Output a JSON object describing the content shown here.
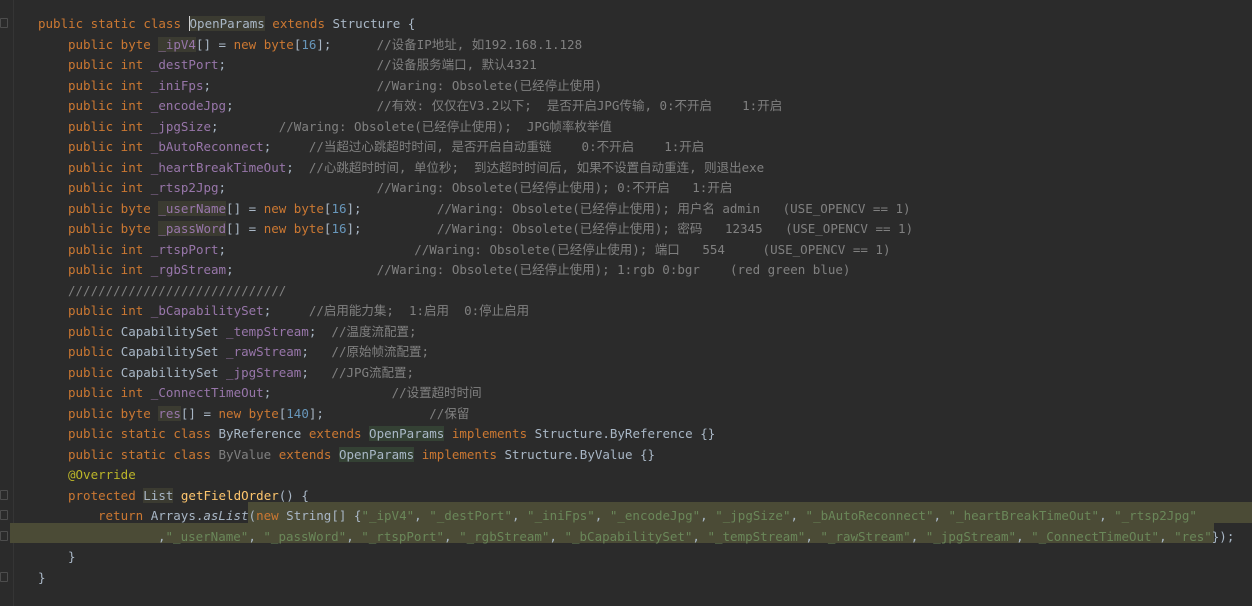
{
  "editor": {
    "language": "java",
    "lines": [
      {
        "indent": 0,
        "parts": [
          [
            "public static class ",
            "kw"
          ],
          [
            "OpenParams",
            "hl caret-before"
          ],
          [
            " extends ",
            "kw"
          ],
          [
            "Structure {",
            ""
          ]
        ]
      },
      {
        "indent": 1,
        "parts": [
          [
            "public byte ",
            "kw"
          ],
          [
            "_ipV4",
            "hl fld"
          ],
          [
            "[] = ",
            ""
          ],
          [
            "new ",
            "kw"
          ],
          [
            "byte",
            "kw"
          ],
          [
            "[",
            ""
          ],
          [
            "16",
            "num"
          ],
          [
            "];",
            ""
          ],
          [
            "      //设备IP地址, 如192.168.1.128",
            "cmt"
          ]
        ]
      },
      {
        "indent": 1,
        "parts": [
          [
            "public int ",
            "kw"
          ],
          [
            "_destPort",
            "fld"
          ],
          [
            ";",
            ""
          ],
          [
            "                    //设备服务端口, 默认4321",
            "cmt"
          ]
        ]
      },
      {
        "indent": 1,
        "parts": [
          [
            "public int ",
            "kw"
          ],
          [
            "_iniFps",
            "fld"
          ],
          [
            ";",
            ""
          ],
          [
            "                      //Waring: Obsolete(已经停止使用)",
            "cmt"
          ]
        ]
      },
      {
        "indent": 1,
        "parts": [
          [
            "public int ",
            "kw"
          ],
          [
            "_encodeJpg",
            "fld"
          ],
          [
            ";",
            ""
          ],
          [
            "                   //有效: 仅仅在V3.2以下;  是否开启JPG传输, 0:不开启    1:开启",
            "cmt"
          ]
        ]
      },
      {
        "indent": 1,
        "parts": [
          [
            "public int ",
            "kw"
          ],
          [
            "_jpgSize",
            "fld"
          ],
          [
            ";",
            ""
          ],
          [
            "        //Waring: Obsolete(已经停止使用);  JPG帧率枚举值",
            "cmt"
          ]
        ]
      },
      {
        "indent": 1,
        "parts": [
          [
            "public int ",
            "kw"
          ],
          [
            "_bAutoReconnect",
            "fld"
          ],
          [
            ";",
            ""
          ],
          [
            "     //当超过心跳超时时间, 是否开启自动重链    0:不开启    1:开启",
            "cmt"
          ]
        ]
      },
      {
        "indent": 1,
        "parts": [
          [
            "public int ",
            "kw"
          ],
          [
            "_heartBreakTimeOut",
            "fld"
          ],
          [
            ";",
            ""
          ],
          [
            "  //心跳超时时间, 单位秒;  到达超时时间后, 如果不设置自动重连, 则退出exe",
            "cmt"
          ]
        ]
      },
      {
        "indent": 1,
        "parts": [
          [
            "public int ",
            "kw"
          ],
          [
            "_rtsp2Jpg",
            "fld"
          ],
          [
            ";",
            ""
          ],
          [
            "                    //Waring: Obsolete(已经停止使用); 0:不开启   1:开启",
            "cmt"
          ]
        ]
      },
      {
        "indent": 1,
        "parts": [
          [
            "public byte ",
            "kw"
          ],
          [
            "_userName",
            "hl fld"
          ],
          [
            "[] = ",
            ""
          ],
          [
            "new ",
            "kw"
          ],
          [
            "byte",
            "kw"
          ],
          [
            "[",
            ""
          ],
          [
            "16",
            "num"
          ],
          [
            "];",
            ""
          ],
          [
            "          //Waring: Obsolete(已经停止使用); 用户名 admin   (USE_OPENCV == 1)",
            "cmt"
          ]
        ]
      },
      {
        "indent": 1,
        "parts": [
          [
            "public byte ",
            "kw"
          ],
          [
            "_passWord",
            "hl fld"
          ],
          [
            "[] = ",
            ""
          ],
          [
            "new ",
            "kw"
          ],
          [
            "byte",
            "kw"
          ],
          [
            "[",
            ""
          ],
          [
            "16",
            "num"
          ],
          [
            "];",
            ""
          ],
          [
            "          //Waring: Obsolete(已经停止使用); 密码   12345   (USE_OPENCV == 1)",
            "cmt"
          ]
        ]
      },
      {
        "indent": 1,
        "parts": [
          [
            "public int ",
            "kw"
          ],
          [
            "_rtspPort",
            "fld"
          ],
          [
            ";",
            ""
          ],
          [
            "                         //Waring: Obsolete(已经停止使用); 端口   554     (USE_OPENCV == 1)",
            "cmt"
          ]
        ]
      },
      {
        "indent": 1,
        "parts": [
          [
            "public int ",
            "kw"
          ],
          [
            "_rgbStream",
            "fld"
          ],
          [
            ";",
            ""
          ],
          [
            "                   //Waring: Obsolete(已经停止使用); 1:rgb 0:bgr    (red green blue)",
            "cmt"
          ]
        ]
      },
      {
        "indent": 1,
        "parts": [
          [
            "/////////////////////////////",
            "cmt"
          ]
        ]
      },
      {
        "indent": 1,
        "parts": [
          [
            "public int ",
            "kw"
          ],
          [
            "_bCapabilitySet",
            "fld"
          ],
          [
            ";",
            ""
          ],
          [
            "     //启用能力集;  1:启用  0:停止启用",
            "cmt"
          ]
        ]
      },
      {
        "indent": 1,
        "parts": [
          [
            "public ",
            "kw"
          ],
          [
            "CapabilitySet ",
            ""
          ],
          [
            "_tempStream",
            "fld"
          ],
          [
            ";",
            ""
          ],
          [
            "  //温度流配置;",
            "cmt"
          ]
        ]
      },
      {
        "indent": 1,
        "parts": [
          [
            "public ",
            "kw"
          ],
          [
            "CapabilitySet ",
            ""
          ],
          [
            "_rawStream",
            "fld"
          ],
          [
            ";",
            ""
          ],
          [
            "   //原始帧流配置;",
            "cmt"
          ]
        ]
      },
      {
        "indent": 1,
        "parts": [
          [
            "public ",
            "kw"
          ],
          [
            "CapabilitySet ",
            ""
          ],
          [
            "_jpgStream",
            "fld"
          ],
          [
            ";",
            ""
          ],
          [
            "   //JPG流配置;",
            "cmt"
          ]
        ]
      },
      {
        "indent": 1,
        "parts": [
          [
            "public int ",
            "kw"
          ],
          [
            "_ConnectTimeOut",
            "fld"
          ],
          [
            ";",
            ""
          ],
          [
            "                //设置超时时间",
            "cmt"
          ]
        ]
      },
      {
        "indent": 1,
        "parts": [
          [
            "public byte ",
            "kw"
          ],
          [
            "res",
            "hl fld"
          ],
          [
            "[] = ",
            ""
          ],
          [
            "new ",
            "kw"
          ],
          [
            "byte",
            "kw"
          ],
          [
            "[",
            ""
          ],
          [
            "140",
            "num"
          ],
          [
            "];",
            ""
          ],
          [
            "              //保留",
            "cmt"
          ]
        ]
      },
      {
        "indent": 1,
        "parts": [
          [
            "public static class ",
            "kw"
          ],
          [
            "ByReference ",
            ""
          ],
          [
            "extends ",
            "kw"
          ],
          [
            "OpenParams",
            "hl2"
          ],
          [
            " implements ",
            "kw"
          ],
          [
            "Structure.ByReference {}",
            ""
          ]
        ]
      },
      {
        "indent": 1,
        "parts": [
          [
            "public static class ",
            "kw"
          ],
          [
            "ByValue ",
            "cmt"
          ],
          [
            "extends ",
            "kw"
          ],
          [
            "OpenParams",
            "hl2"
          ],
          [
            " implements ",
            "kw"
          ],
          [
            "Structure.ByValue {}",
            ""
          ]
        ]
      },
      {
        "indent": 1,
        "parts": [
          [
            "@Override",
            "ann"
          ]
        ]
      },
      {
        "indent": 1,
        "parts": [
          [
            "protected ",
            "kw"
          ],
          [
            "List",
            "hl"
          ],
          [
            " ",
            ""
          ],
          [
            "getFieldOrder",
            "mth"
          ],
          [
            "() {",
            ""
          ]
        ]
      },
      {
        "indent": 2,
        "parts": [
          [
            "return ",
            "kw"
          ],
          [
            "Arrays.",
            ""
          ],
          [
            "asList",
            "itl"
          ],
          [
            "(",
            ""
          ],
          [
            "new ",
            "kw"
          ],
          [
            "String[] {",
            ""
          ],
          [
            "\"_ipV4\"",
            "str"
          ],
          [
            ", ",
            ""
          ],
          [
            "\"_destPort\"",
            "str"
          ],
          [
            ", ",
            ""
          ],
          [
            "\"_iniFps\"",
            "str"
          ],
          [
            ", ",
            ""
          ],
          [
            "\"_encodeJpg\"",
            "str"
          ],
          [
            ", ",
            ""
          ],
          [
            "\"_jpgSize\"",
            "str"
          ],
          [
            ", ",
            ""
          ],
          [
            "\"_bAutoReconnect\"",
            "str"
          ],
          [
            ", ",
            ""
          ],
          [
            "\"_heartBreakTimeOut\"",
            "str"
          ],
          [
            ", ",
            ""
          ],
          [
            "\"_rtsp2Jpg\"",
            "str"
          ]
        ]
      },
      {
        "indent": 4,
        "parts": [
          [
            ",",
            ""
          ],
          [
            "\"_userName\"",
            "str"
          ],
          [
            ", ",
            ""
          ],
          [
            "\"_passWord\"",
            "str"
          ],
          [
            ", ",
            ""
          ],
          [
            "\"_rtspPort\"",
            "str"
          ],
          [
            ", ",
            ""
          ],
          [
            "\"_rgbStream\"",
            "str"
          ],
          [
            ", ",
            ""
          ],
          [
            "\"_bCapabilitySet\"",
            "str"
          ],
          [
            ", ",
            ""
          ],
          [
            "\"_tempStream\"",
            "str"
          ],
          [
            ", ",
            ""
          ],
          [
            "\"_rawStream\"",
            "str"
          ],
          [
            ", ",
            ""
          ],
          [
            "\"_jpgStream\"",
            "str"
          ],
          [
            ", ",
            ""
          ],
          [
            "\"_ConnectTimeOut\"",
            "str"
          ],
          [
            ", ",
            ""
          ],
          [
            "\"res\"",
            "str"
          ],
          [
            "});",
            ""
          ]
        ]
      },
      {
        "indent": 1,
        "parts": [
          [
            "}",
            ""
          ]
        ]
      },
      {
        "indent": 0,
        "parts": [
          [
            "}",
            ""
          ]
        ]
      }
    ]
  }
}
